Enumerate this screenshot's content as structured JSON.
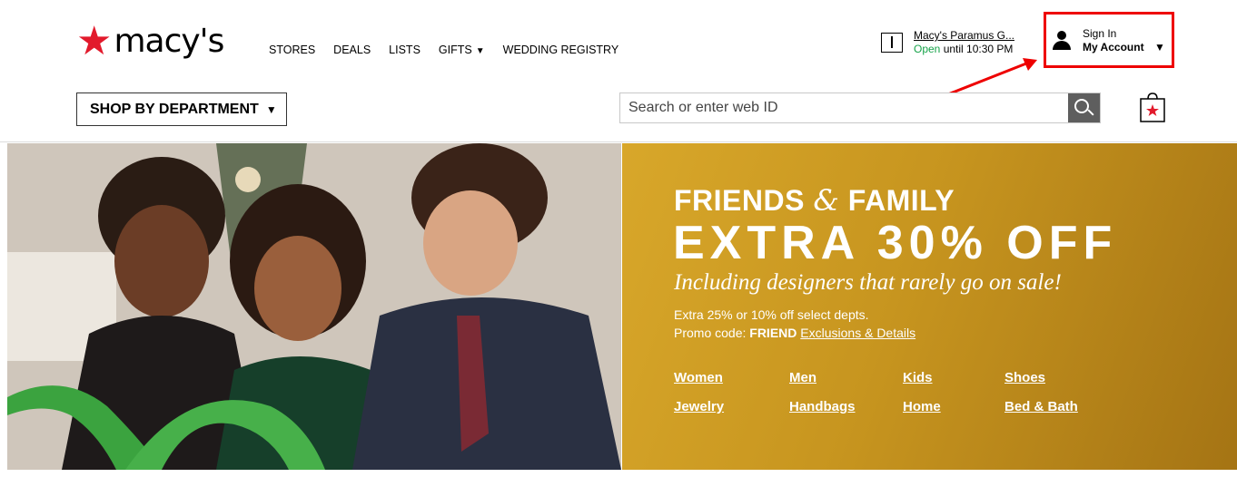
{
  "logo": {
    "text": "macy's",
    "star": "★"
  },
  "topnav": {
    "stores": "STORES",
    "deals": "DEALS",
    "lists": "LISTS",
    "gifts": "GIFTS",
    "wedding": "WEDDING REGISTRY",
    "caret": "▼"
  },
  "store": {
    "name": "Macy's Paramus G...",
    "status": "Open",
    "until": " until 10:30 PM"
  },
  "account": {
    "sign_in": "Sign In",
    "my_account": "My Account",
    "caret": "▼"
  },
  "department": {
    "label": "SHOP BY DEPARTMENT",
    "caret": "▼"
  },
  "search": {
    "placeholder": "Search or enter web ID"
  },
  "promo": {
    "line1_a": "FRIENDS ",
    "line1_amp": "&",
    "line1_b": " FAMILY",
    "line2": "EXTRA 30% OFF",
    "line3": "Including designers that rarely go on sale!",
    "small1": "Extra 25% or 10% off select depts.",
    "promo_prefix": "Promo code: ",
    "promo_code": "FRIEND",
    "exclusions": "Exclusions & Details",
    "categories": [
      "Women",
      "Men",
      "Kids",
      "Shoes",
      "Jewelry",
      "Handbags",
      "Home",
      "Bed & Bath"
    ]
  },
  "colors": {
    "brand_red": "#e21a2c",
    "highlight": "#ee0000",
    "open_green": "#17a34a",
    "promo_gold": "#c7951f"
  }
}
